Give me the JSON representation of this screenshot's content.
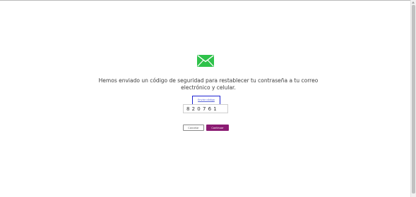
{
  "message": "Hemos enviado un código de seguridad para restablecer tu contraseña a tu correo electrónico y celular.",
  "resend_link_label": "Enviar código",
  "code_input_value": "820761",
  "buttons": {
    "cancel_label": "Cancelar",
    "continue_label": "Continuar"
  },
  "icons": {
    "mail": "envelope-icon"
  },
  "colors": {
    "mail_icon": "#2ec24a",
    "continue_button": "#8b1b72",
    "focus_outline": "#1d22d2"
  }
}
